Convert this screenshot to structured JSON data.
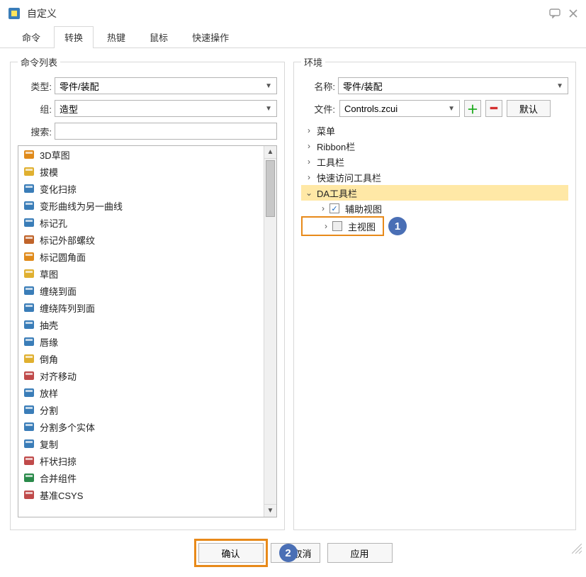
{
  "titlebar": {
    "title": "自定义"
  },
  "tabs": {
    "items": [
      {
        "label": "命令"
      },
      {
        "label": "转换"
      },
      {
        "label": "热键"
      },
      {
        "label": "鼠标"
      },
      {
        "label": "快速操作"
      }
    ],
    "active_index": 1
  },
  "left_panel": {
    "legend": "命令列表",
    "type_label": "类型:",
    "type_value": "零件/装配",
    "group_label": "组:",
    "group_value": "造型",
    "search_label": "搜索:",
    "search_value": "",
    "commands": [
      {
        "label": "3D草图",
        "icon_color": "#e08a1a"
      },
      {
        "label": "拔模",
        "icon_color": "#e0b030"
      },
      {
        "label": "变化扫掠",
        "icon_color": "#3a7db8"
      },
      {
        "label": "变形曲线为另一曲线",
        "icon_color": "#3a7db8"
      },
      {
        "label": "标记孔",
        "icon_color": "#3a7db8"
      },
      {
        "label": "标记外部螺纹",
        "icon_color": "#c0642a"
      },
      {
        "label": "标记圆角面",
        "icon_color": "#e08a1a"
      },
      {
        "label": "草图",
        "icon_color": "#e0b030"
      },
      {
        "label": "缠绕到面",
        "icon_color": "#3a7db8"
      },
      {
        "label": "缠绕阵列到面",
        "icon_color": "#3a7db8"
      },
      {
        "label": "抽壳",
        "icon_color": "#3a7db8"
      },
      {
        "label": "唇缘",
        "icon_color": "#3a7db8"
      },
      {
        "label": "倒角",
        "icon_color": "#e0b030"
      },
      {
        "label": "对齐移动",
        "icon_color": "#c04a4a"
      },
      {
        "label": "放样",
        "icon_color": "#3a7db8"
      },
      {
        "label": "分割",
        "icon_color": "#3a7db8"
      },
      {
        "label": "分割多个实体",
        "icon_color": "#3a7db8"
      },
      {
        "label": "复制",
        "icon_color": "#3a7db8"
      },
      {
        "label": "杆状扫掠",
        "icon_color": "#c04a4a"
      },
      {
        "label": "合并组件",
        "icon_color": "#2a8a4a"
      },
      {
        "label": "基准CSYS",
        "icon_color": "#c04a4a"
      }
    ]
  },
  "right_panel": {
    "legend": "环境",
    "name_label": "名称:",
    "name_value": "零件/装配",
    "file_label": "文件:",
    "file_value": "Controls.zcui",
    "default_label": "默认",
    "tree": [
      {
        "label": "菜单",
        "indent": 1,
        "expander": "›",
        "selected": false
      },
      {
        "label": "Ribbon栏",
        "indent": 1,
        "expander": "›",
        "selected": false
      },
      {
        "label": "工具栏",
        "indent": 1,
        "expander": "›",
        "selected": false
      },
      {
        "label": "快速访问工具栏",
        "indent": 1,
        "expander": "›",
        "selected": false
      },
      {
        "label": "DA工具栏",
        "indent": 1,
        "expander": "⌄",
        "selected": true
      },
      {
        "label": "辅助视图",
        "indent": 2,
        "expander": "›",
        "checkbox": true,
        "checked": true,
        "highlight": false
      },
      {
        "label": "主视图",
        "indent": 2,
        "expander": "›",
        "checkbox": true,
        "checked": false,
        "highlight": true
      }
    ]
  },
  "buttons": {
    "ok": "确认",
    "cancel": "取消",
    "apply": "应用"
  },
  "callouts": {
    "one": "1",
    "two": "2"
  }
}
